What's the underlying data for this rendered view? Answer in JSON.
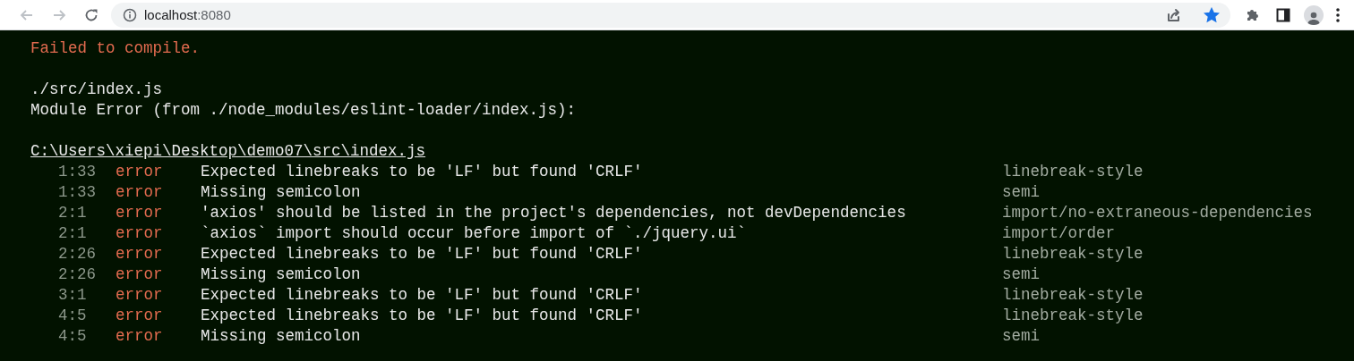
{
  "browser": {
    "url_host": "localhost",
    "url_port": ":8080",
    "bookmarked": true
  },
  "overlay": {
    "title": "Failed to compile.",
    "file": "./src/index.js",
    "module_error": "Module Error (from ./node_modules/eslint-loader/index.js):",
    "path": "C:\\Users\\xiepi\\Desktop\\demo07\\src\\index.js",
    "problems": [
      {
        "position": "1:33",
        "severity": "error",
        "message": "Expected linebreaks to be 'LF' but found 'CRLF'",
        "rule": "linebreak-style"
      },
      {
        "position": "1:33",
        "severity": "error",
        "message": "Missing semicolon",
        "rule": "semi"
      },
      {
        "position": "2:1",
        "severity": "error",
        "message": "'axios' should be listed in the project's dependencies, not devDependencies",
        "rule": "import/no-extraneous-dependencies"
      },
      {
        "position": "2:1",
        "severity": "error",
        "message": "`axios` import should occur before import of `./jquery.ui`",
        "rule": "import/order"
      },
      {
        "position": "2:26",
        "severity": "error",
        "message": "Expected linebreaks to be 'LF' but found 'CRLF'",
        "rule": "linebreak-style"
      },
      {
        "position": "2:26",
        "severity": "error",
        "message": "Missing semicolon",
        "rule": "semi"
      },
      {
        "position": "3:1",
        "severity": "error",
        "message": "Expected linebreaks to be 'LF' but found 'CRLF'",
        "rule": "linebreak-style"
      },
      {
        "position": "4:5",
        "severity": "error",
        "message": "Expected linebreaks to be 'LF' but found 'CRLF'",
        "rule": "linebreak-style"
      },
      {
        "position": "4:5",
        "severity": "error",
        "message": "Missing semicolon",
        "rule": "semi"
      }
    ]
  }
}
